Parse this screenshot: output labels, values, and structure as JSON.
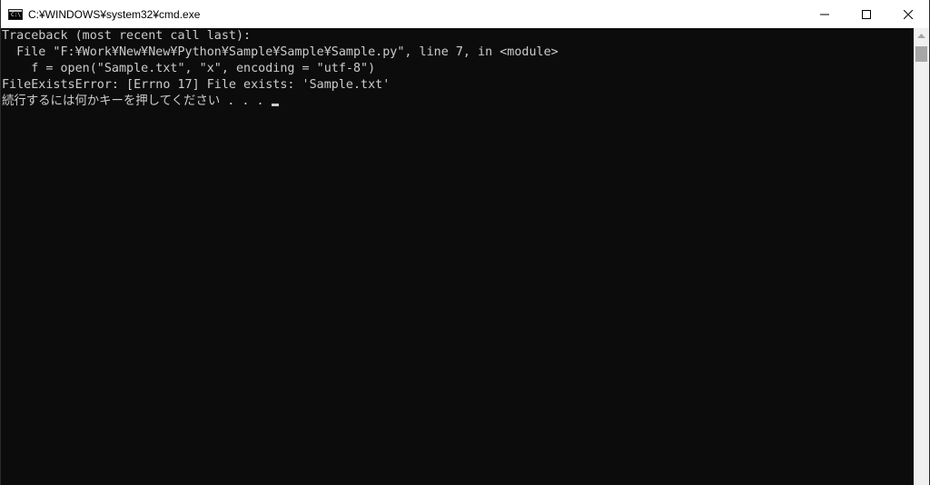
{
  "window": {
    "title": "C:¥WINDOWS¥system32¥cmd.exe",
    "icon": "C:\\",
    "controls": {
      "minimize": "minimize-icon",
      "maximize": "maximize-icon",
      "close": "close-icon"
    }
  },
  "console": {
    "lines": [
      "Traceback (most recent call last):",
      "  File \"F:¥Work¥New¥New¥Python¥Sample¥Sample¥Sample.py\", line 7, in <module>",
      "    f = open(\"Sample.txt\", \"x\", encoding = \"utf-8\")",
      "FileExistsError: [Errno 17] File exists: 'Sample.txt'",
      "続行するには何かキーを押してください . . . "
    ],
    "text_color": "#cccccc",
    "background": "#0c0c0c"
  }
}
